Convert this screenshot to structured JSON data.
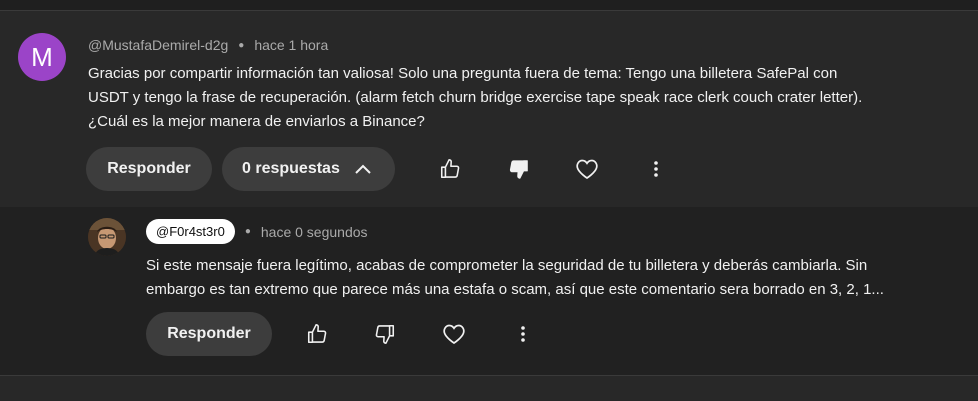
{
  "comments": [
    {
      "avatar_letter": "M",
      "avatar_color": "#9b44c8",
      "author": "@MustafaDemirel-d2g",
      "time": "hace 1 hora",
      "text_lines": [
        "Gracias por compartir información tan valiosa! Solo una pregunta fuera de tema: Tengo una billetera SafePal con",
        "USDT y tengo la frase de recuperación. (alarm fetch churn bridge exercise tape speak race clerk couch crater letter).",
        "¿Cuál es la mejor manera de enviarlos a Binance?"
      ],
      "reply_label": "Responder",
      "replies_label": "0 respuestas",
      "icons": [
        "thumb-up-icon",
        "thumb-down-icon",
        "heart-icon",
        "more-vert-icon"
      ]
    },
    {
      "author": "@F0r4st3r0",
      "time": "hace 0 segundos",
      "text_lines": [
        "Si este mensaje fuera legítimo, acabas de comprometer la seguridad de tu billetera y deberás cambiarla. Sin",
        "embargo es tan extremo que parece más una estafa o scam, así que este comentario sera borrado en 3, 2, 1..."
      ],
      "reply_label": "Responder",
      "icons": [
        "thumb-up-icon",
        "thumb-down-icon",
        "heart-icon",
        "more-vert-icon"
      ]
    }
  ]
}
